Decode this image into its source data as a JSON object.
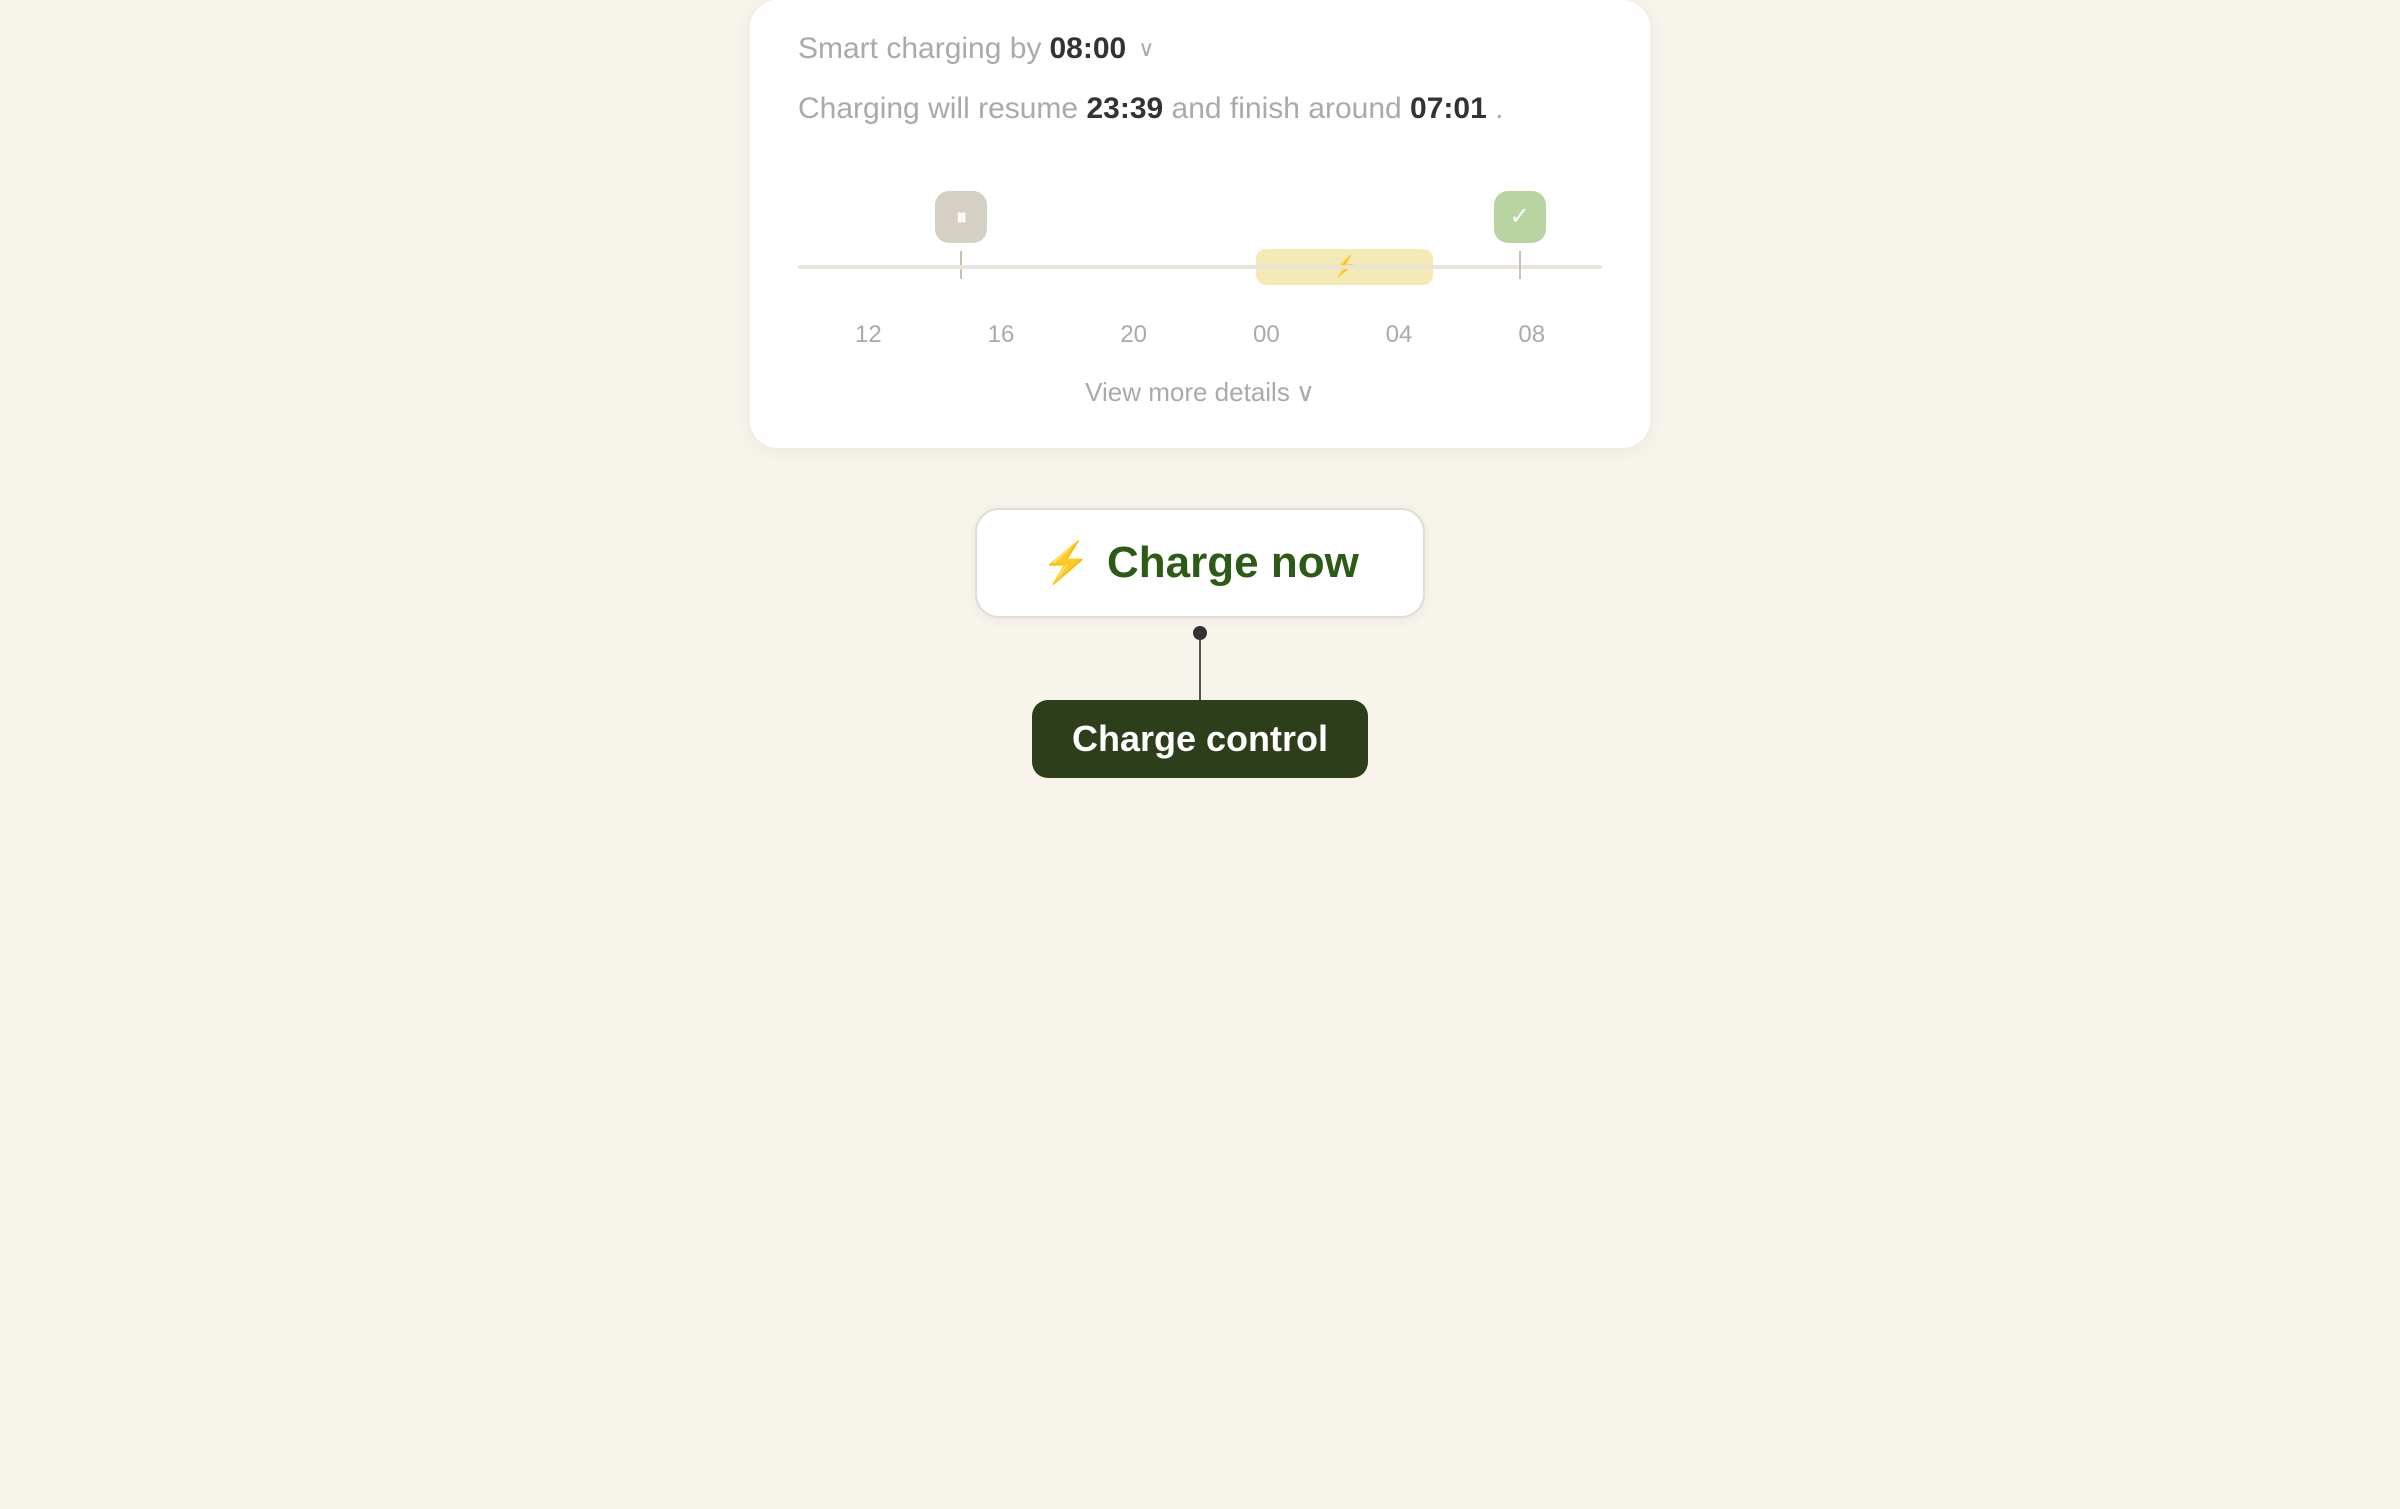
{
  "page": {
    "background_color": "#f7f4ec"
  },
  "card": {
    "smart_charging_label": "Smart charging by",
    "smart_charging_time": "08:00",
    "charging_description_before": "Charging will resume",
    "charging_resume_time": "23:39",
    "charging_description_middle": "and finish around",
    "charging_finish_time": "07:01",
    "charging_description_period": ".",
    "view_more_label": "View more details",
    "chevron_down": "∨"
  },
  "timeline": {
    "time_labels": [
      "12",
      "16",
      "20",
      "00",
      "04",
      "08"
    ]
  },
  "charge_now_button": {
    "icon": "⚡",
    "label": "Charge now"
  },
  "tooltip": {
    "text": "Charge control"
  }
}
